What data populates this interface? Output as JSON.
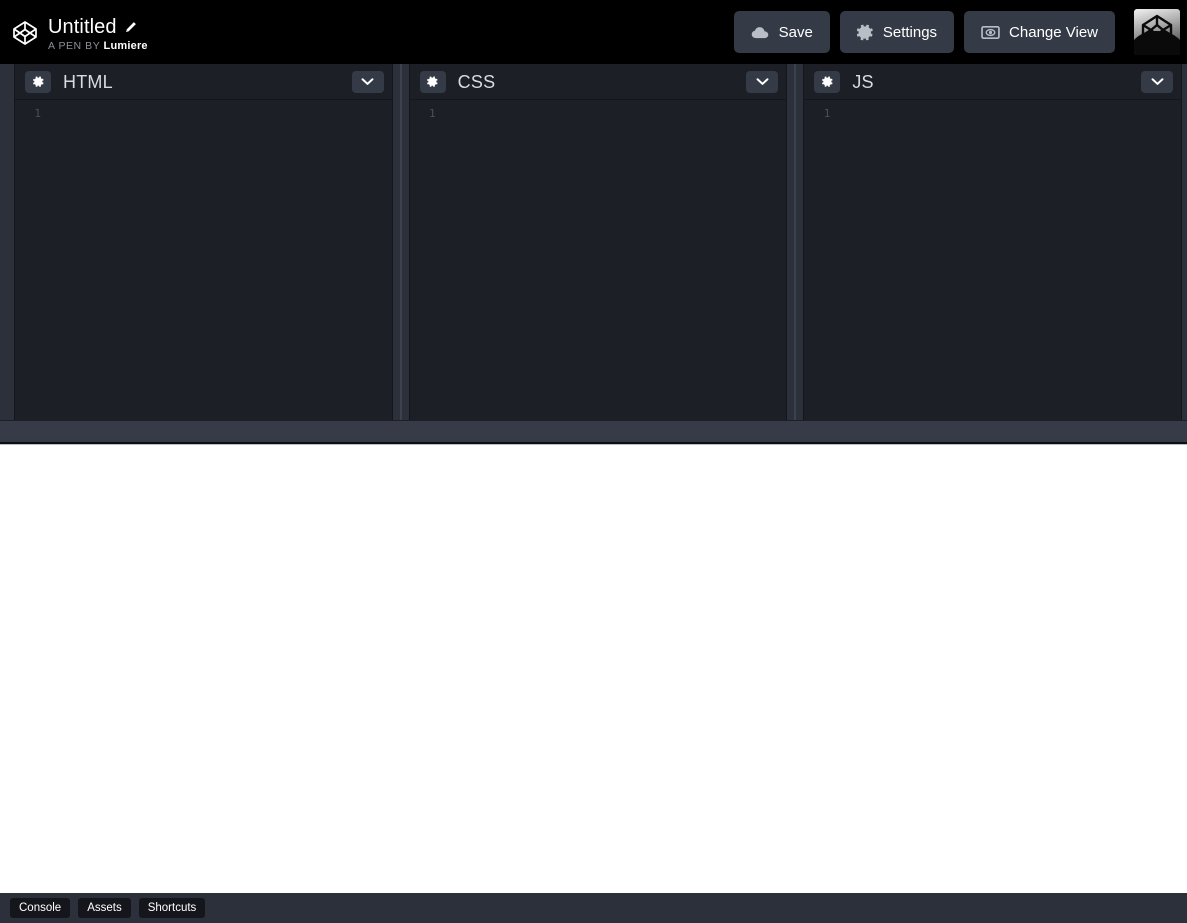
{
  "topbar": {
    "logo_icon": "codepen-logo-icon",
    "pen_title": "Untitled",
    "edit_icon": "pencil-icon",
    "byline_prefix": "A PEN BY",
    "author": "Lumiere",
    "buttons": [
      {
        "label": "Save",
        "icon": "cloud-icon"
      },
      {
        "label": "Settings",
        "icon": "gear-icon"
      },
      {
        "label": "Change View",
        "icon": "eye-view-icon"
      }
    ],
    "avatar_icon": "user-avatar"
  },
  "editors": [
    {
      "title": "HTML",
      "settings_icon": "gear-icon",
      "collapse_icon": "chevron-down-icon",
      "line_numbers": [
        "1"
      ],
      "lines": [
        ""
      ]
    },
    {
      "title": "CSS",
      "settings_icon": "gear-icon",
      "collapse_icon": "chevron-down-icon",
      "line_numbers": [
        "1"
      ],
      "lines": [
        ""
      ]
    },
    {
      "title": "JS",
      "settings_icon": "gear-icon",
      "collapse_icon": "chevron-down-icon",
      "line_numbers": [
        "1"
      ],
      "lines": [
        ""
      ]
    }
  ],
  "preview": {
    "content": ""
  },
  "bottombar": {
    "buttons": [
      {
        "label": "Console"
      },
      {
        "label": "Assets"
      },
      {
        "label": "Shortcuts"
      }
    ]
  },
  "colors": {
    "topbar_bg": "#000000",
    "app_bg": "#2c303a",
    "pane_bg": "#1d1f26",
    "button_bg": "#343a46",
    "accent_text": "#ffffff",
    "muted_text": "#8b8f98",
    "dragbar_bg": "#363b47",
    "preview_bg": "#ffffff",
    "bottom_btn_bg": "#14161b"
  }
}
